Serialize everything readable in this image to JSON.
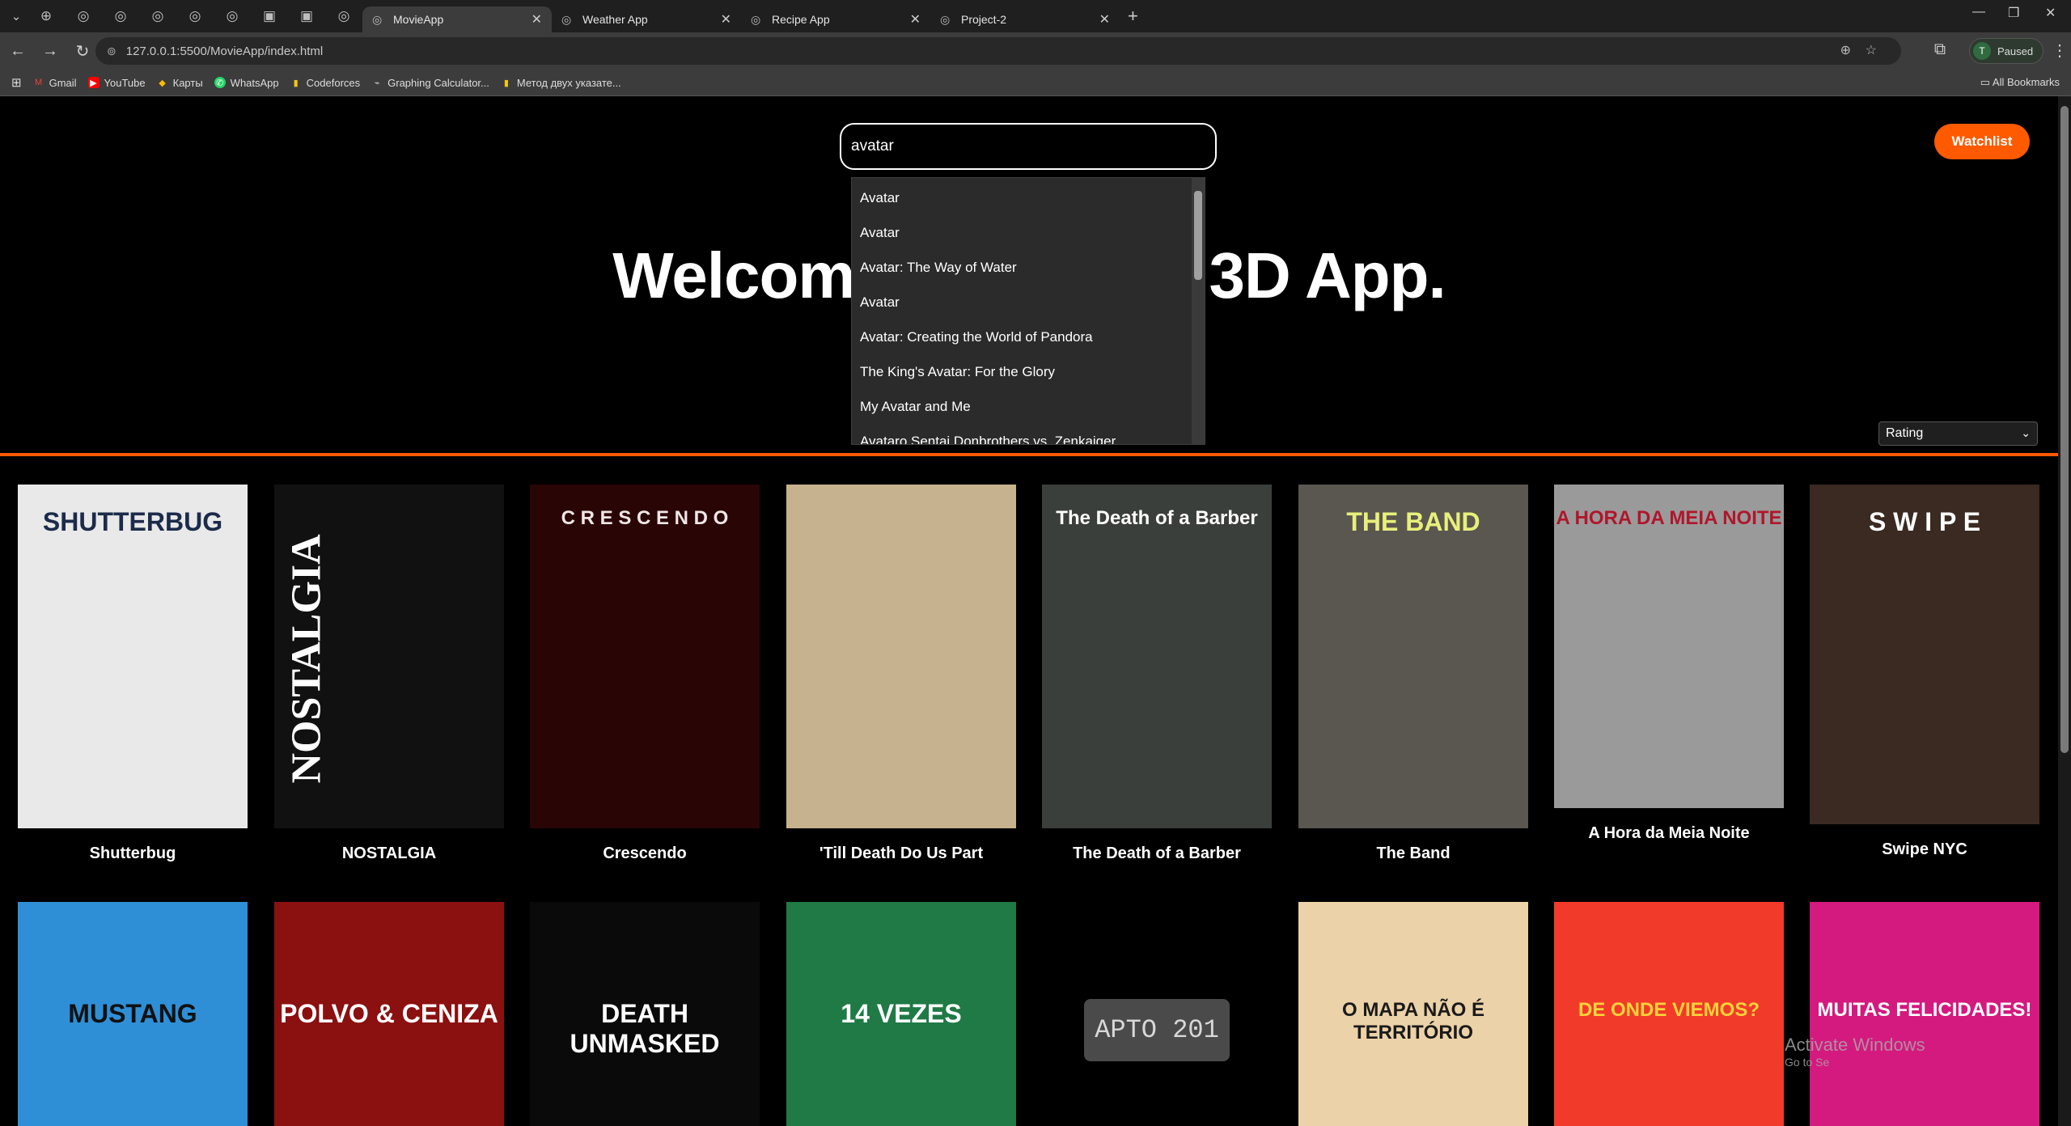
{
  "browser": {
    "tabs": [
      {
        "title": "MovieApp",
        "active": true
      },
      {
        "title": "Weather App",
        "active": false
      },
      {
        "title": "Recipe App",
        "active": false
      },
      {
        "title": "Project-2",
        "active": false
      }
    ],
    "url": "127.0.0.1:5500/MovieApp/index.html",
    "profile_initial": "T",
    "profile_status": "Paused",
    "bookmarks": [
      "Gmail",
      "YouTube",
      "Карты",
      "WhatsApp",
      "Codeforces",
      "Graphing Calculator...",
      "Метод двух указате..."
    ],
    "all_bookmarks": "All Bookmarks"
  },
  "app": {
    "search_value": "avatar",
    "watchlist_label": "Watchlist",
    "hero_left": "Welcom",
    "hero_right": "3D App.",
    "suggestions": [
      "Avatar",
      "Avatar",
      "Avatar: The Way of Water",
      "Avatar",
      "Avatar: Creating the World of Pandora",
      "The King's Avatar: For the Glory",
      "My Avatar and Me",
      "Avataro Sentai Donbrothers vs. Zenkaiger"
    ],
    "sort_value": "Rating"
  },
  "movies": [
    {
      "title": "Shutterbug",
      "poster_text": "SHUTTERBUG",
      "bg": "#e9e9e9",
      "fg": "#1c2b4a"
    },
    {
      "title": "NOSTALGIA",
      "poster_text": "NOSTALGIA",
      "bg": "#111111",
      "fg": "#ffffff"
    },
    {
      "title": "Crescendo",
      "poster_text": "C R E S C E N D O",
      "bg": "#2a0506",
      "fg": "#f0e6e6"
    },
    {
      "title": "'Till Death Do Us Part",
      "poster_text": "",
      "bg": "#c7b28f",
      "fg": "#3a2a1a"
    },
    {
      "title": "The Death of a Barber",
      "poster_text": "The Death of a Barber",
      "bg": "#3b3f3b",
      "fg": "#ffffff"
    },
    {
      "title": "The Band",
      "poster_text": "THE BAND",
      "bg": "#5a5650",
      "fg": "#e7f07a"
    },
    {
      "title": "A Hora da Meia Noite",
      "poster_text": "A HORA DA MEIA NOITE",
      "bg": "#9a9a9a",
      "fg": "#b0162b"
    },
    {
      "title": "Swipe NYC",
      "poster_text": "S W I P E",
      "bg": "#3a2a22",
      "fg": "#ffffff"
    },
    {
      "title": "",
      "poster_text": "MUSTANG",
      "bg": "#2f8fd6",
      "fg": "#111111"
    },
    {
      "title": "",
      "poster_text": "POLVO & CENIZA",
      "bg": "#8b1010",
      "fg": "#ffffff"
    },
    {
      "title": "",
      "poster_text": "DEATH UNMASKED",
      "bg": "#0a0a0a",
      "fg": "#ffffff"
    },
    {
      "title": "",
      "poster_text": "14 VEZES",
      "bg": "#1f7a45",
      "fg": "#ffffff"
    },
    {
      "title": "",
      "poster_text": "APTO 201",
      "bg": "#000000",
      "fg": "#d8d8d8"
    },
    {
      "title": "",
      "poster_text": "O MAPA NÃO É TERRITÓRIO",
      "bg": "#ecd2a8",
      "fg": "#1a1a1a"
    },
    {
      "title": "",
      "poster_text": "DE ONDE VIEMOS?",
      "bg": "#f23a2a",
      "fg": "#ffd33a"
    },
    {
      "title": "",
      "poster_text": "MUITAS FELICIDADES!",
      "bg": "#d4197f",
      "fg": "#ffffff"
    }
  ],
  "watermark": {
    "line1": "Activate Windows",
    "line2": "Go to Se"
  }
}
